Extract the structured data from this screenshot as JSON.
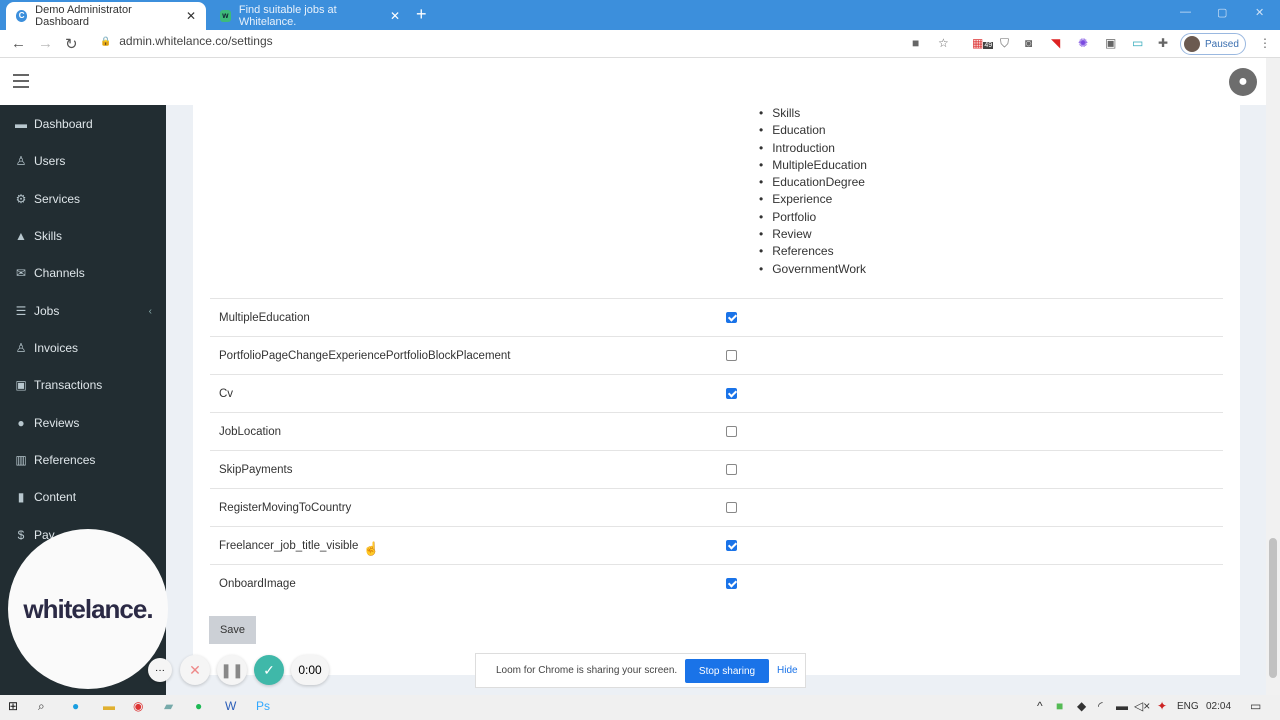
{
  "browser": {
    "tabs": [
      {
        "title": "Demo Administrator Dashboard",
        "active": true
      },
      {
        "title": "Find suitable jobs at Whitelance.",
        "active": false
      }
    ],
    "url": "admin.whitelance.co/settings",
    "extension_badge": "49",
    "profile_status": "Paused"
  },
  "sidebar": {
    "items": [
      {
        "label": "Dashboard",
        "icon": "dashboard-icon"
      },
      {
        "label": "Users",
        "icon": "user-icon"
      },
      {
        "label": "Services",
        "icon": "gear-icon"
      },
      {
        "label": "Skills",
        "icon": "graduation-cap-icon"
      },
      {
        "label": "Channels",
        "icon": "envelope-icon"
      },
      {
        "label": "Jobs",
        "icon": "list-icon",
        "has_submenu": true
      },
      {
        "label": "Invoices",
        "icon": "user-icon"
      },
      {
        "label": "Transactions",
        "icon": "money-icon"
      },
      {
        "label": "Reviews",
        "icon": "comments-icon"
      },
      {
        "label": "References",
        "icon": "bank-icon"
      },
      {
        "label": "Content",
        "icon": "file-icon"
      },
      {
        "label": "Pay",
        "icon": "dollar-icon"
      }
    ]
  },
  "main": {
    "list_items": [
      "Skills",
      "Education",
      "Introduction",
      "MultipleEducation",
      "EducationDegree",
      "Experience",
      "Portfolio",
      "Review",
      "References",
      "GovernmentWork"
    ],
    "settings": [
      {
        "name": "MultipleEducation",
        "checked": true
      },
      {
        "name": "PortfolioPageChangeExperiencePortfolioBlockPlacement",
        "checked": false
      },
      {
        "name": "Cv",
        "checked": true
      },
      {
        "name": "JobLocation",
        "checked": false
      },
      {
        "name": "SkipPayments",
        "checked": false
      },
      {
        "name": "RegisterMovingToCountry",
        "checked": false
      },
      {
        "name": "Freelancer_job_title_visible",
        "checked": true
      },
      {
        "name": "OnboardImage",
        "checked": true
      }
    ],
    "save_label": "Save"
  },
  "loom": {
    "message": "Loom for Chrome is sharing your screen.",
    "stop_label": "Stop sharing",
    "hide_label": "Hide",
    "timer": "0:00",
    "logo_text": "whitelance."
  },
  "taskbar": {
    "language": "ENG",
    "time": "02:04"
  },
  "colors": {
    "accent": "#1a73e8",
    "sidebar": "#222d32",
    "tabbar": "#3c8fdc"
  }
}
